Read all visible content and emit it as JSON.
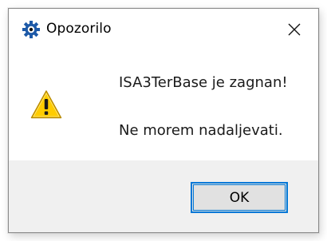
{
  "window": {
    "title": "Opozorilo",
    "app_icon": "gear-icon",
    "close_icon": "close-icon"
  },
  "message": {
    "icon": "warning-icon",
    "line1": "ISA3TerBase je zagnan!",
    "line2": "Ne morem nadaljevati."
  },
  "buttons": {
    "ok_label": "OK"
  },
  "colors": {
    "focus_border": "#0078d7",
    "footer_bg": "#f0f0f0",
    "button_bg": "#e1e1e1",
    "warning_yellow": "#ffcc00",
    "app_icon_blue": "#1e5aa8"
  }
}
